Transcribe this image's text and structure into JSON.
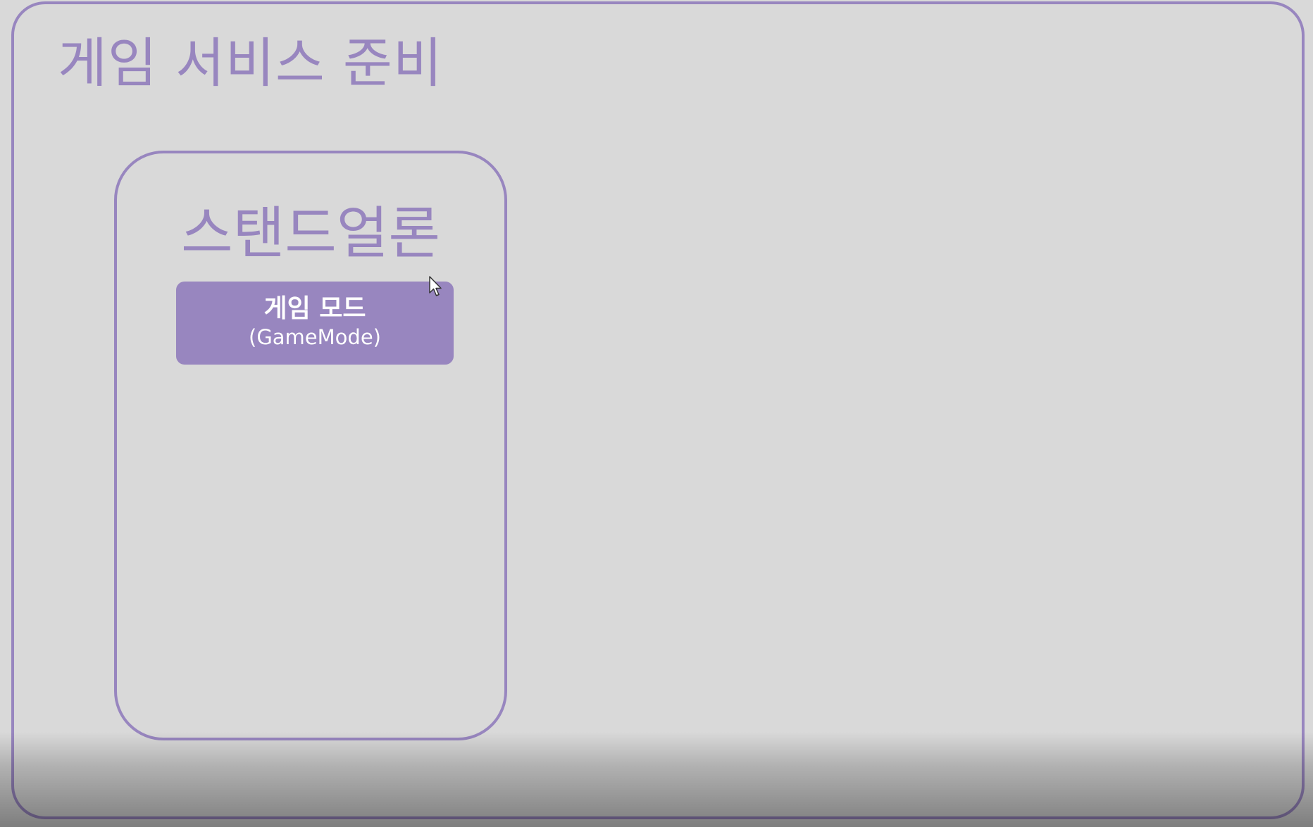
{
  "slide": {
    "title": "게임 서비스 준비",
    "panel": {
      "title": "스탠드얼론",
      "node": {
        "title": "게임 모드",
        "subtitle": "(GameMode)"
      }
    }
  },
  "colors": {
    "background": "#d9d9d9",
    "accent": "#9886bf",
    "node_text": "#ffffff"
  },
  "icons": {
    "cursor": "mouse-pointer-icon"
  }
}
